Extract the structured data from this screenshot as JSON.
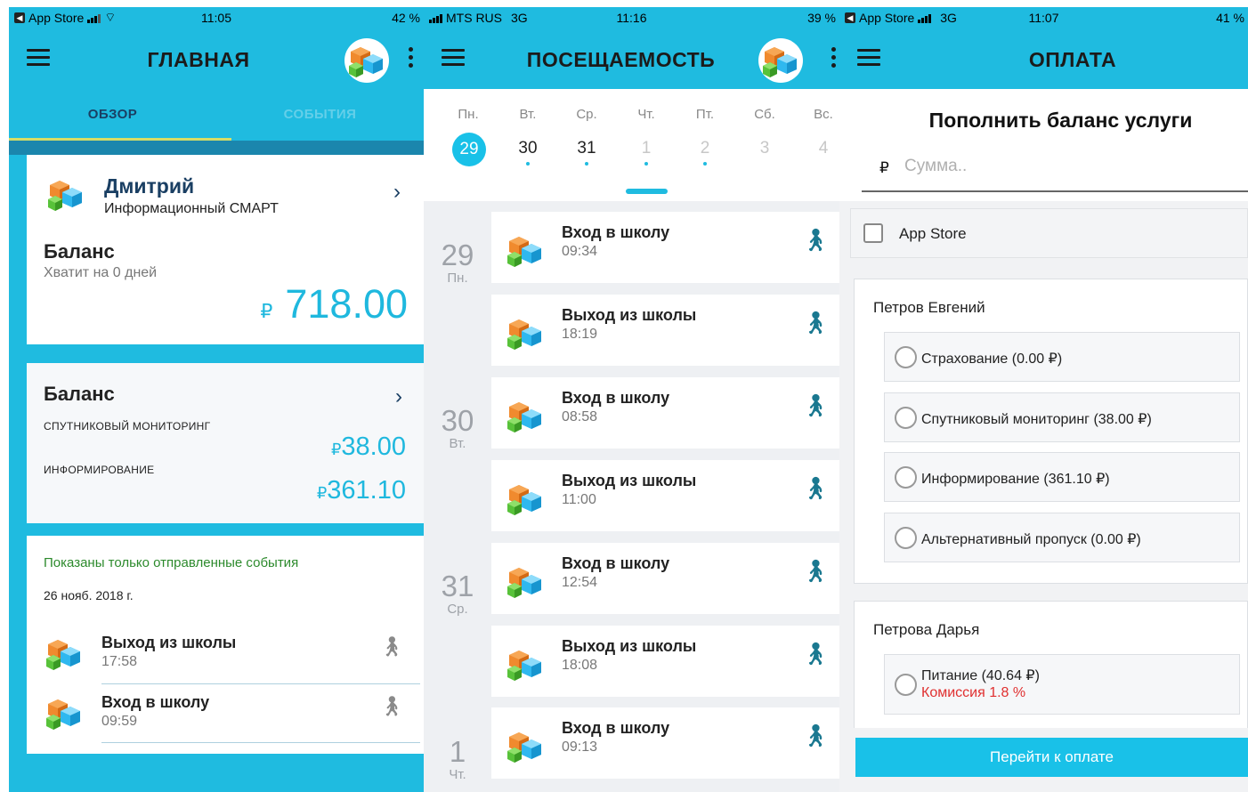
{
  "screen1": {
    "status": {
      "carrier": "App Store",
      "time": "11:05",
      "battery": "42 %"
    },
    "title": "ГЛАВНАЯ",
    "tabs": [
      {
        "label": "ОБЗОР"
      },
      {
        "label": "СОБЫТИЯ"
      }
    ],
    "profile": {
      "name": "Дмитрий",
      "subtitle": "Информационный СМАРТ",
      "balance_label": "Баланс",
      "balance_days": "Хватит на 0 дней",
      "currency": "₽",
      "balance": "718.00"
    },
    "services": {
      "title": "Баланс",
      "items": [
        {
          "label": "СПУТНИКОВЫЙ МОНИТОРИНГ",
          "currency": "₽",
          "amount": "38.00"
        },
        {
          "label": "ИНФОРМИРОВАНИЕ",
          "currency": "₽",
          "amount": "361.10"
        }
      ]
    },
    "events": {
      "note": "Показаны только отправленные события",
      "date": "26 нояб. 2018 г.",
      "items": [
        {
          "title": "Выход из школы",
          "time": "17:58"
        },
        {
          "title": "Вход в школу",
          "time": "09:59"
        }
      ]
    }
  },
  "screen2": {
    "status": {
      "carrier": "MTS RUS",
      "network": "3G",
      "time": "11:16",
      "battery": "39 %"
    },
    "title": "ПОСЕЩАЕМОСТЬ",
    "week": [
      {
        "name": "Пн.",
        "num": "29",
        "selected": true,
        "dot": true,
        "muted": false
      },
      {
        "name": "Вт.",
        "num": "30",
        "selected": false,
        "dot": true,
        "muted": false
      },
      {
        "name": "Ср.",
        "num": "31",
        "selected": false,
        "dot": true,
        "muted": false
      },
      {
        "name": "Чт.",
        "num": "1",
        "selected": false,
        "dot": true,
        "muted": true
      },
      {
        "name": "Пт.",
        "num": "2",
        "selected": false,
        "dot": true,
        "muted": true
      },
      {
        "name": "Сб.",
        "num": "3",
        "selected": false,
        "dot": false,
        "muted": true
      },
      {
        "name": "Вс.",
        "num": "4",
        "selected": false,
        "dot": false,
        "muted": true
      }
    ],
    "days": [
      {
        "num": "29",
        "name": "Пн."
      },
      {
        "num": "30",
        "name": "Вт."
      },
      {
        "num": "31",
        "name": "Ср."
      },
      {
        "num": "1",
        "name": "Чт."
      }
    ],
    "records": [
      {
        "title": "Вход в школу",
        "time": "09:34"
      },
      {
        "title": "Выход из школы",
        "time": "18:19"
      },
      {
        "title": "Вход в школу",
        "time": "08:58"
      },
      {
        "title": "Выход из школы",
        "time": "11:00"
      },
      {
        "title": "Вход в школу",
        "time": "12:54"
      },
      {
        "title": "Выход из школы",
        "time": "18:08"
      },
      {
        "title": "Вход в школу",
        "time": "09:13"
      }
    ]
  },
  "screen3": {
    "status": {
      "carrier": "App Store",
      "network": "3G",
      "time": "11:07",
      "battery": "41 %"
    },
    "title": "ОПЛАТА",
    "heading": "Пополнить баланс услуги",
    "currency": "₽",
    "amount_placeholder": "Сумма..",
    "store_label": "App Store",
    "groups": [
      {
        "name": "Петров Евгений",
        "options": [
          {
            "label": "Страхование (0.00 ₽)"
          },
          {
            "label": "Спутниковый мониторинг (38.00 ₽)"
          },
          {
            "label": "Информирование (361.10 ₽)"
          },
          {
            "label": "Альтернативный пропуск (0.00 ₽)"
          }
        ]
      },
      {
        "name": "Петрова Дарья",
        "options": [
          {
            "label": "Питание (40.64 ₽)",
            "note": "Комиссия 1.8 %"
          }
        ]
      }
    ],
    "pay_button": "Перейти к оплате"
  },
  "colors": {
    "accent": "#1fbbe0",
    "dark_header": "#1a3f63",
    "tab_underline": "#d6dd66",
    "note_green": "#2c8a2c",
    "commission_red": "#e03030"
  },
  "icons": {
    "menu": "menu-icon",
    "more": "more-vert-icon",
    "chevron": "chevron-right-icon",
    "walk": "walk-icon",
    "logo": "cubes-logo-icon"
  }
}
